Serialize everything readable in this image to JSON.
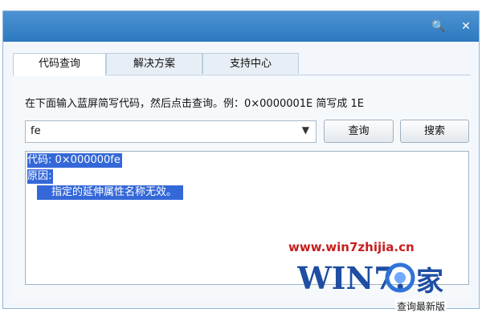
{
  "window": {
    "search_icon": "🔍",
    "close_icon": "✕"
  },
  "tabs": [
    {
      "label": "代码查询"
    },
    {
      "label": "解决方案"
    },
    {
      "label": "支持中心"
    }
  ],
  "query": {
    "instruction": "在下面输入蓝屏简写代码，然后点击查询。例：0×0000001E 简写成 1E",
    "input_value": "fe",
    "query_button": "查询",
    "search_button": "搜索"
  },
  "result": {
    "line1": "代码: 0×000000fe",
    "line2": "原因:",
    "line3": "指定的延伸属性名称无效。"
  },
  "watermark": {
    "url": "www.win7zhijia.cn",
    "logo_text": "WIN7.之家"
  },
  "footer": {
    "version": "查询最新版"
  }
}
